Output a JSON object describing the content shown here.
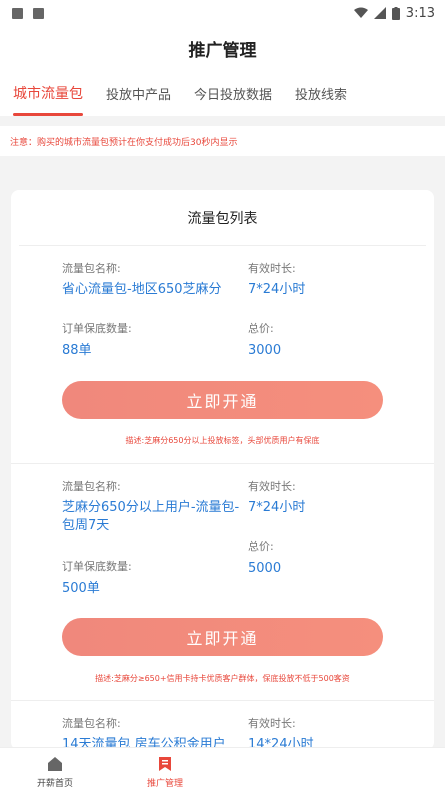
{
  "status_bar": {
    "time": "3:13",
    "icons": [
      "image-icon",
      "text-icon",
      "wifi-icon",
      "signal-icon",
      "battery-icon"
    ]
  },
  "header": {
    "title": "推广管理"
  },
  "tabs": [
    {
      "label": "城市流量包",
      "active": true
    },
    {
      "label": "投放中产品"
    },
    {
      "label": "今日投放数据"
    },
    {
      "label": "投放线索"
    }
  ],
  "notice": "注意：购买的城市流量包预计在你支付成功后30秒内显示",
  "card": {
    "title": "流量包列表"
  },
  "packages": [
    {
      "name_label": "流量包名称:",
      "name": "省心流量包-地区650芝麻分",
      "duration_label": "有效时长:",
      "duration": "7*24小时",
      "orders_label": "订单保底数量:",
      "orders": "88单",
      "price_label": "总价:",
      "price": "3000",
      "button": "立即开通",
      "desc": "描述:芝麻分650分以上投放标签，头部优质用户有保底"
    },
    {
      "name_label": "流量包名称:",
      "name": "芝麻分650分以上用户-流量包-包周7天",
      "duration_label": "有效时长:",
      "duration": "7*24小时",
      "orders_label": "订单保底数量:",
      "orders": "500单",
      "price_label": "总价:",
      "price": "5000",
      "button": "立即开通",
      "desc": "描述:芝麻分≥650+信用卡持卡优质客户群体，保底投放不低于500客资"
    },
    {
      "name_label": "流量包名称:",
      "name": "14天流量包 房车公积金用户",
      "duration_label": "有效时长:",
      "duration": "14*24小时"
    }
  ],
  "tabbar": [
    {
      "label": "开薪首页",
      "icon": "home-icon"
    },
    {
      "label": "推广管理",
      "icon": "bookmark-icon",
      "active": true
    },
    {
      "label": ""
    },
    {
      "label": ""
    }
  ],
  "colors": {
    "accent": "#e8473b",
    "button": "#f58f7d",
    "value_blue": "#2a7bd4"
  }
}
